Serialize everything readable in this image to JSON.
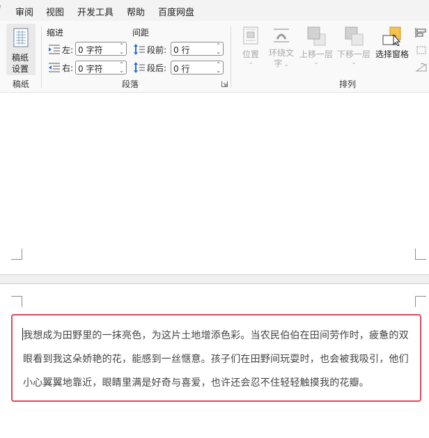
{
  "menu": {
    "items": [
      "审阅",
      "视图",
      "开发工具",
      "帮助",
      "百度网盘"
    ]
  },
  "ribbon": {
    "manuscript": {
      "button_label_line1": "稿纸",
      "button_label_line2": "设置",
      "group_label": "稿纸"
    },
    "paragraph": {
      "indent_header": "缩进",
      "spacing_header": "间距",
      "left_label": "左:",
      "left_value": "0 字符",
      "right_label": "右:",
      "right_value": "0 字符",
      "before_label": "段前:",
      "before_value": "0 行",
      "after_label": "段后:",
      "after_value": "0 行",
      "group_label": "段落"
    },
    "arrange": {
      "position_label": "位置",
      "wrap_label_line1": "环绕文",
      "wrap_label_line2": "字",
      "bring_forward_label": "上移一层",
      "send_backward_label": "下移一层",
      "selection_pane_label": "选择窗格",
      "group_label": "排列"
    }
  },
  "document": {
    "paragraph_lines": [
      "我想成为田野里的一抹亮色，为这片土地增添色彩。当农民伯伯在田间劳作时，疲惫的双",
      "眼看到我这朵娇艳的花，能感到一丝惬意。孩子们在田野间玩耍时，也会被我吸引，他们",
      "小心翼翼地靠近，眼睛里满是好奇与喜爱，也许还会忍不住轻轻触摸我的花瓣。"
    ]
  },
  "colors": {
    "textbox_border": "#e0475b",
    "ribbon_bg": "#f9f9f9",
    "menubar_bg": "#f3f3f3"
  }
}
